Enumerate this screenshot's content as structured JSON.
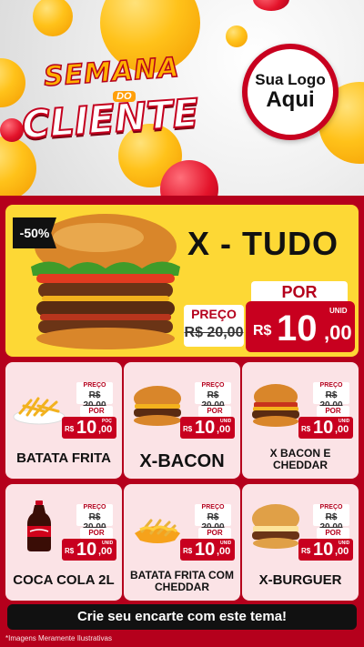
{
  "header": {
    "title_top": "SEMANA",
    "title_do": "DO",
    "title_bottom": "CLIENTE",
    "logo_line1": "Sua Logo",
    "logo_line2": "Aqui"
  },
  "featured": {
    "discount": "-50%",
    "name": "X - TUDO",
    "preco_label": "PREÇO",
    "old_price": "R$ 20,00",
    "por_label": "POR",
    "currency": "R$",
    "price_int": "10",
    "price_cents": ",00",
    "unit": "UNID"
  },
  "products": [
    {
      "name": "BATATA FRITA",
      "preco_label": "PREÇO",
      "old_price": "R$ 20,00",
      "por_label": "POR",
      "currency": "R$",
      "price_int": "10",
      "price_cents": ",00",
      "unit": "POÇ",
      "icon": "fries-icon"
    },
    {
      "name": "X-BACON",
      "preco_label": "PREÇO",
      "old_price": "R$ 20,00",
      "por_label": "POR",
      "currency": "R$",
      "price_int": "10",
      "price_cents": ",00",
      "unit": "UNID",
      "icon": "burger-icon"
    },
    {
      "name": "X BACON E CHEDDAR",
      "preco_label": "PREÇO",
      "old_price": "R$ 20,00",
      "por_label": "POR",
      "currency": "R$",
      "price_int": "10",
      "price_cents": ",00",
      "unit": "UNID",
      "icon": "burger-icon"
    },
    {
      "name": "COCA COLA 2L",
      "preco_label": "PREÇO",
      "old_price": "R$ 20,00",
      "por_label": "POR",
      "currency": "R$",
      "price_int": "10",
      "price_cents": ",00",
      "unit": "UNID",
      "icon": "soda-bottle-icon"
    },
    {
      "name": "BATATA FRITA COM CHEDDAR",
      "preco_label": "PREÇO",
      "old_price": "R$ 20,00",
      "por_label": "POR",
      "currency": "R$",
      "price_int": "10",
      "price_cents": ",00",
      "unit": "UNID",
      "icon": "fries-cheddar-icon"
    },
    {
      "name": "X-BURGUER",
      "preco_label": "PREÇO",
      "old_price": "R$ 20,00",
      "por_label": "POR",
      "currency": "R$",
      "price_int": "10",
      "price_cents": ",00",
      "unit": "UNID",
      "icon": "burger-icon"
    }
  ],
  "cta": "Crie seu encarte com este tema!",
  "footnote": "*Imagens Meramente Ilustrativas",
  "colors": {
    "brand_red": "#c8001f",
    "background_red": "#b5001c",
    "featured_yellow": "#fdd835",
    "card_pink": "#fbe3e6"
  }
}
